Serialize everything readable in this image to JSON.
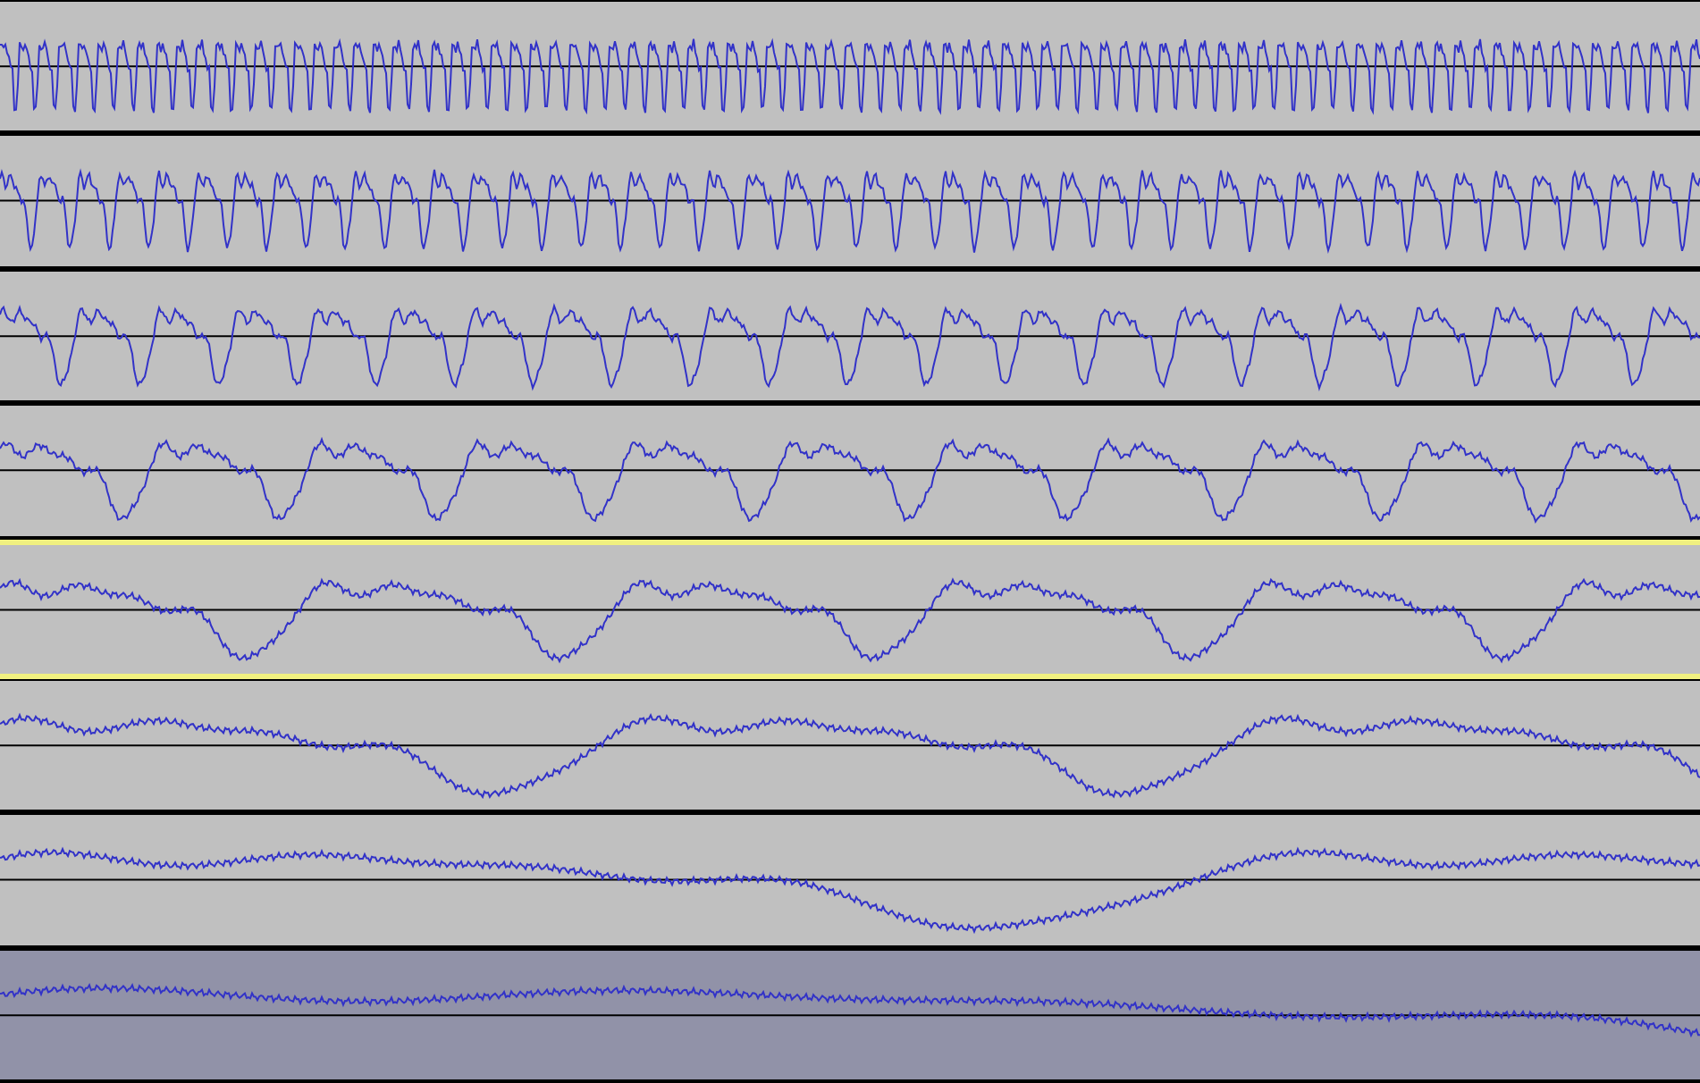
{
  "tracks": [
    {
      "selected": false,
      "focused": false
    },
    {
      "selected": false,
      "focused": false
    },
    {
      "selected": false,
      "focused": false
    },
    {
      "selected": false,
      "focused": false
    },
    {
      "selected": false,
      "focused": true
    },
    {
      "selected": false,
      "focused": false
    },
    {
      "selected": false,
      "focused": false
    },
    {
      "selected": true,
      "focused": false
    }
  ]
}
